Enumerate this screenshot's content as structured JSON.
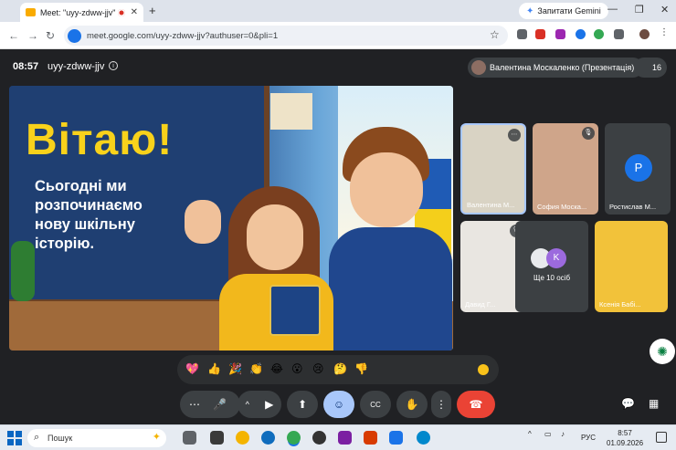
{
  "browser": {
    "tab_title": "Meet: \"uyy-zdww-jjv\"",
    "tab_close": "✕",
    "new_tab": "+",
    "gemini_label": "Запитати Gemini",
    "url": "meet.google.com/uyy-zdww-jjv?authuser=0&pli=1",
    "minimize": "—",
    "maximize": "❐",
    "close": "✕"
  },
  "meet": {
    "time": "08:57",
    "meeting_code": "uyy-zdww-jjv",
    "presenter": "Валентина Москаленко (Презентація)",
    "participants_count": "16",
    "slide": {
      "title": "Вітаю!",
      "subtitle": "Сьогодні ми розпочинаємо нову шкільну історію."
    },
    "tiles": [
      {
        "name": "Валентина М...",
        "bg": "#d9d3c4"
      },
      {
        "name": "София Моска...",
        "bg": "#cfa58a"
      },
      {
        "name": "Ростислав М...",
        "initial": "Р"
      },
      {
        "name": "Давид Г...",
        "bg": "#e9e6e1"
      },
      {
        "more_label": "Ще 10 осіб",
        "initial": "K"
      },
      {
        "name": "Ксенія Бабі...",
        "bg": "#f2c23a"
      }
    ],
    "reactions": [
      "💖",
      "👍",
      "🎉",
      "👏",
      "😂",
      "😮",
      "😢",
      "🤔",
      "👎"
    ],
    "controls": {
      "more": "⋯",
      "mic": "🎤",
      "chevron": "^",
      "camera": "▶",
      "present": "⬆",
      "emoji": "☺",
      "captions": "CC",
      "hand": "✋",
      "options": "⋮",
      "end": "☎"
    },
    "right_controls": {
      "chat": "💬",
      "activities": "▦"
    }
  },
  "taskbar": {
    "search": "Пошук",
    "lang": "РУС",
    "time": "8:57",
    "date": "01.09.2026"
  }
}
